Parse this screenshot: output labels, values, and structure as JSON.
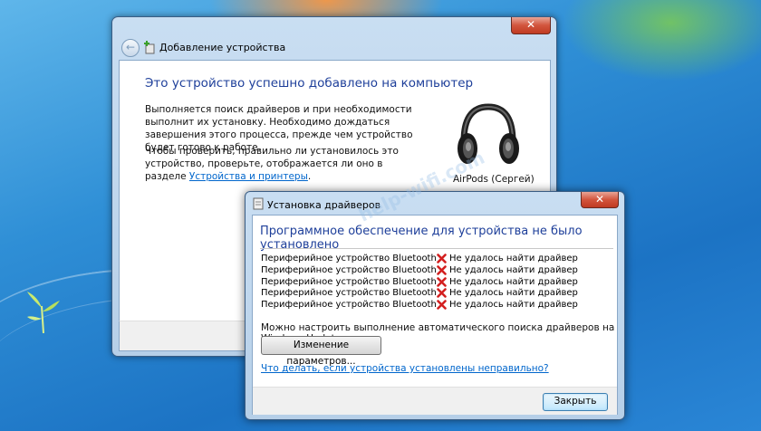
{
  "window_add_device": {
    "title": "Добавление устройства",
    "close_glyph": "✕",
    "back_glyph": "←",
    "headline": "Это устройство успешно добавлено на компьютер",
    "paragraph1": "Выполняется поиск драйверов и при необходимости выполнит их установку. Необходимо дождаться завершения этого процесса, прежде чем устройство будет готово к работе.",
    "paragraph2_text": "Чтобы проверить, правильно ли установилось это устройство, проверьте, отображается ли оно в разделе ",
    "paragraph2_link": "Устройства и принтеры",
    "paragraph2_end": ".",
    "device_name": "AirPods (Сергей)",
    "device_icon": "headphones-icon"
  },
  "window_driver_install": {
    "title": "Установка драйверов",
    "close_glyph": "✕",
    "headline": "Программное обеспечение для устройства не было установлено",
    "rows": [
      {
        "device": "Периферийное устройство Bluetooth",
        "status": "Не удалось найти драйвер"
      },
      {
        "device": "Периферийное устройство Bluetooth",
        "status": "Не удалось найти драйвер"
      },
      {
        "device": "Периферийное устройство Bluetooth",
        "status": "Не удалось найти драйвер"
      },
      {
        "device": "Периферийное устройство Bluetooth",
        "status": "Не удалось найти драйвер"
      },
      {
        "device": "Периферийное устройство Bluetooth",
        "status": "Не удалось найти драйвер"
      }
    ],
    "auto_search_text": "Можно настроить выполнение автоматического поиска драйверов на Windows Update",
    "change_settings_button": "Изменение параметров...",
    "help_link": "Что делать, если устройства установлены неправильно?",
    "close_button": "Закрыть"
  },
  "watermark": "help-wifi.com",
  "colors": {
    "accent_text": "#1e3f9a",
    "link": "#0066cc",
    "error": "#d32020"
  }
}
